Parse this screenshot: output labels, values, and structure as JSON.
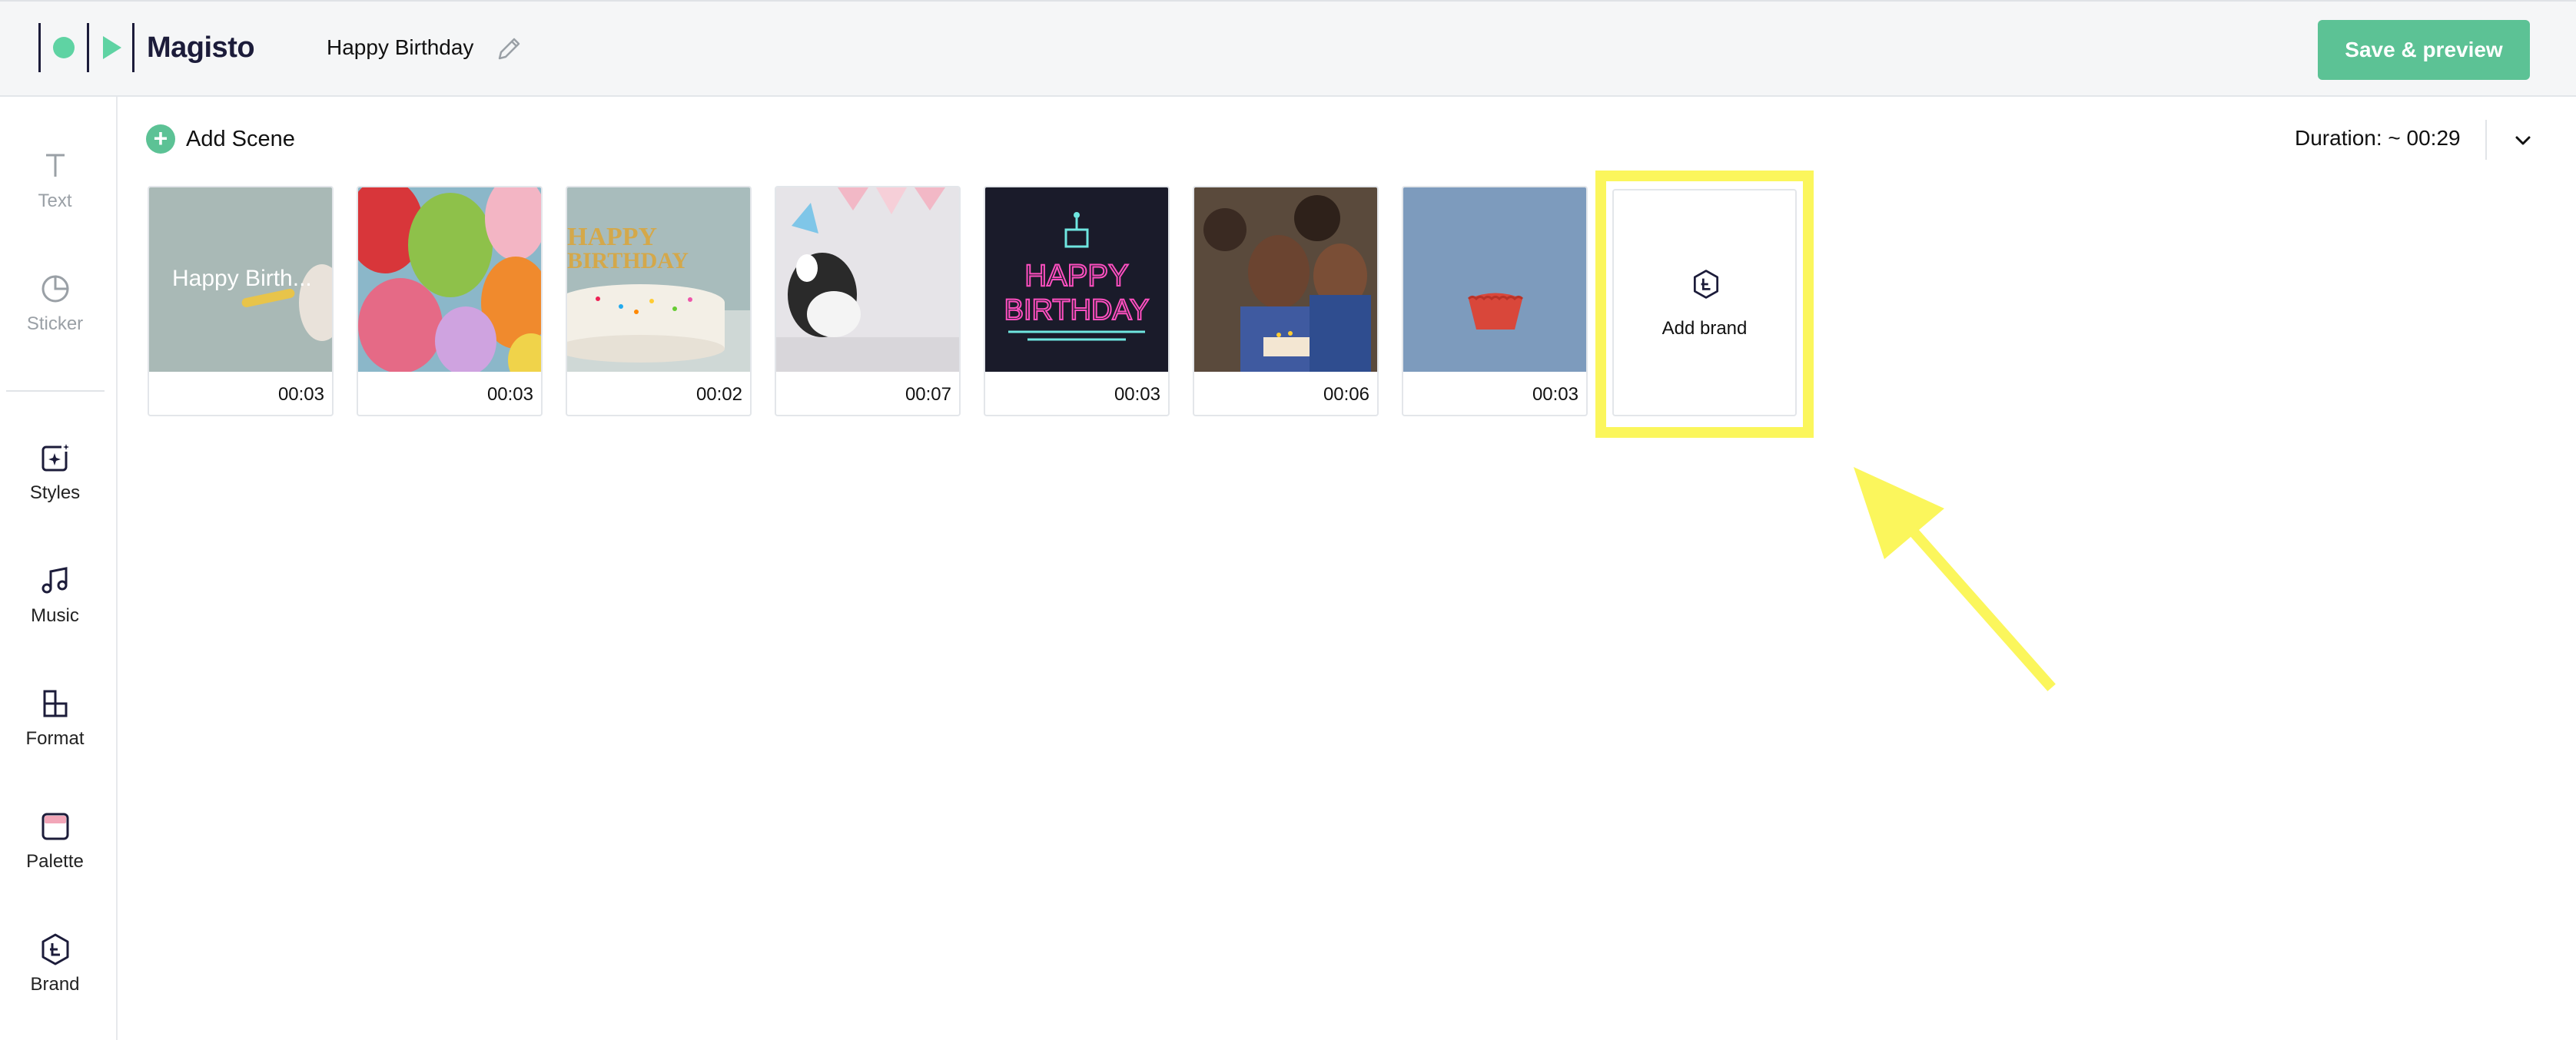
{
  "header": {
    "logo_text": "Magisto",
    "project_title": "Happy Birthday",
    "save_label": "Save & preview"
  },
  "sidebar": {
    "items": [
      {
        "label": "Text",
        "icon": "text-icon"
      },
      {
        "label": "Sticker",
        "icon": "sticker-icon"
      },
      {
        "label": "Styles",
        "icon": "styles-icon"
      },
      {
        "label": "Music",
        "icon": "music-icon"
      },
      {
        "label": "Format",
        "icon": "format-icon"
      },
      {
        "label": "Palette",
        "icon": "palette-icon"
      },
      {
        "label": "Brand",
        "icon": "brand-icon"
      }
    ]
  },
  "main": {
    "add_scene_label": "Add Scene",
    "duration_label": "Duration: ~ 00:29",
    "scenes": [
      {
        "time": "00:03",
        "overlay_text": "Happy Birth..."
      },
      {
        "time": "00:03"
      },
      {
        "time": "00:02"
      },
      {
        "time": "00:07"
      },
      {
        "time": "00:03"
      },
      {
        "time": "00:06"
      },
      {
        "time": "00:03"
      }
    ],
    "add_brand_label": "Add brand"
  },
  "colors": {
    "accent": "#5cc295",
    "highlight": "#fbf65c",
    "brand_dark": "#1c1c3a"
  }
}
